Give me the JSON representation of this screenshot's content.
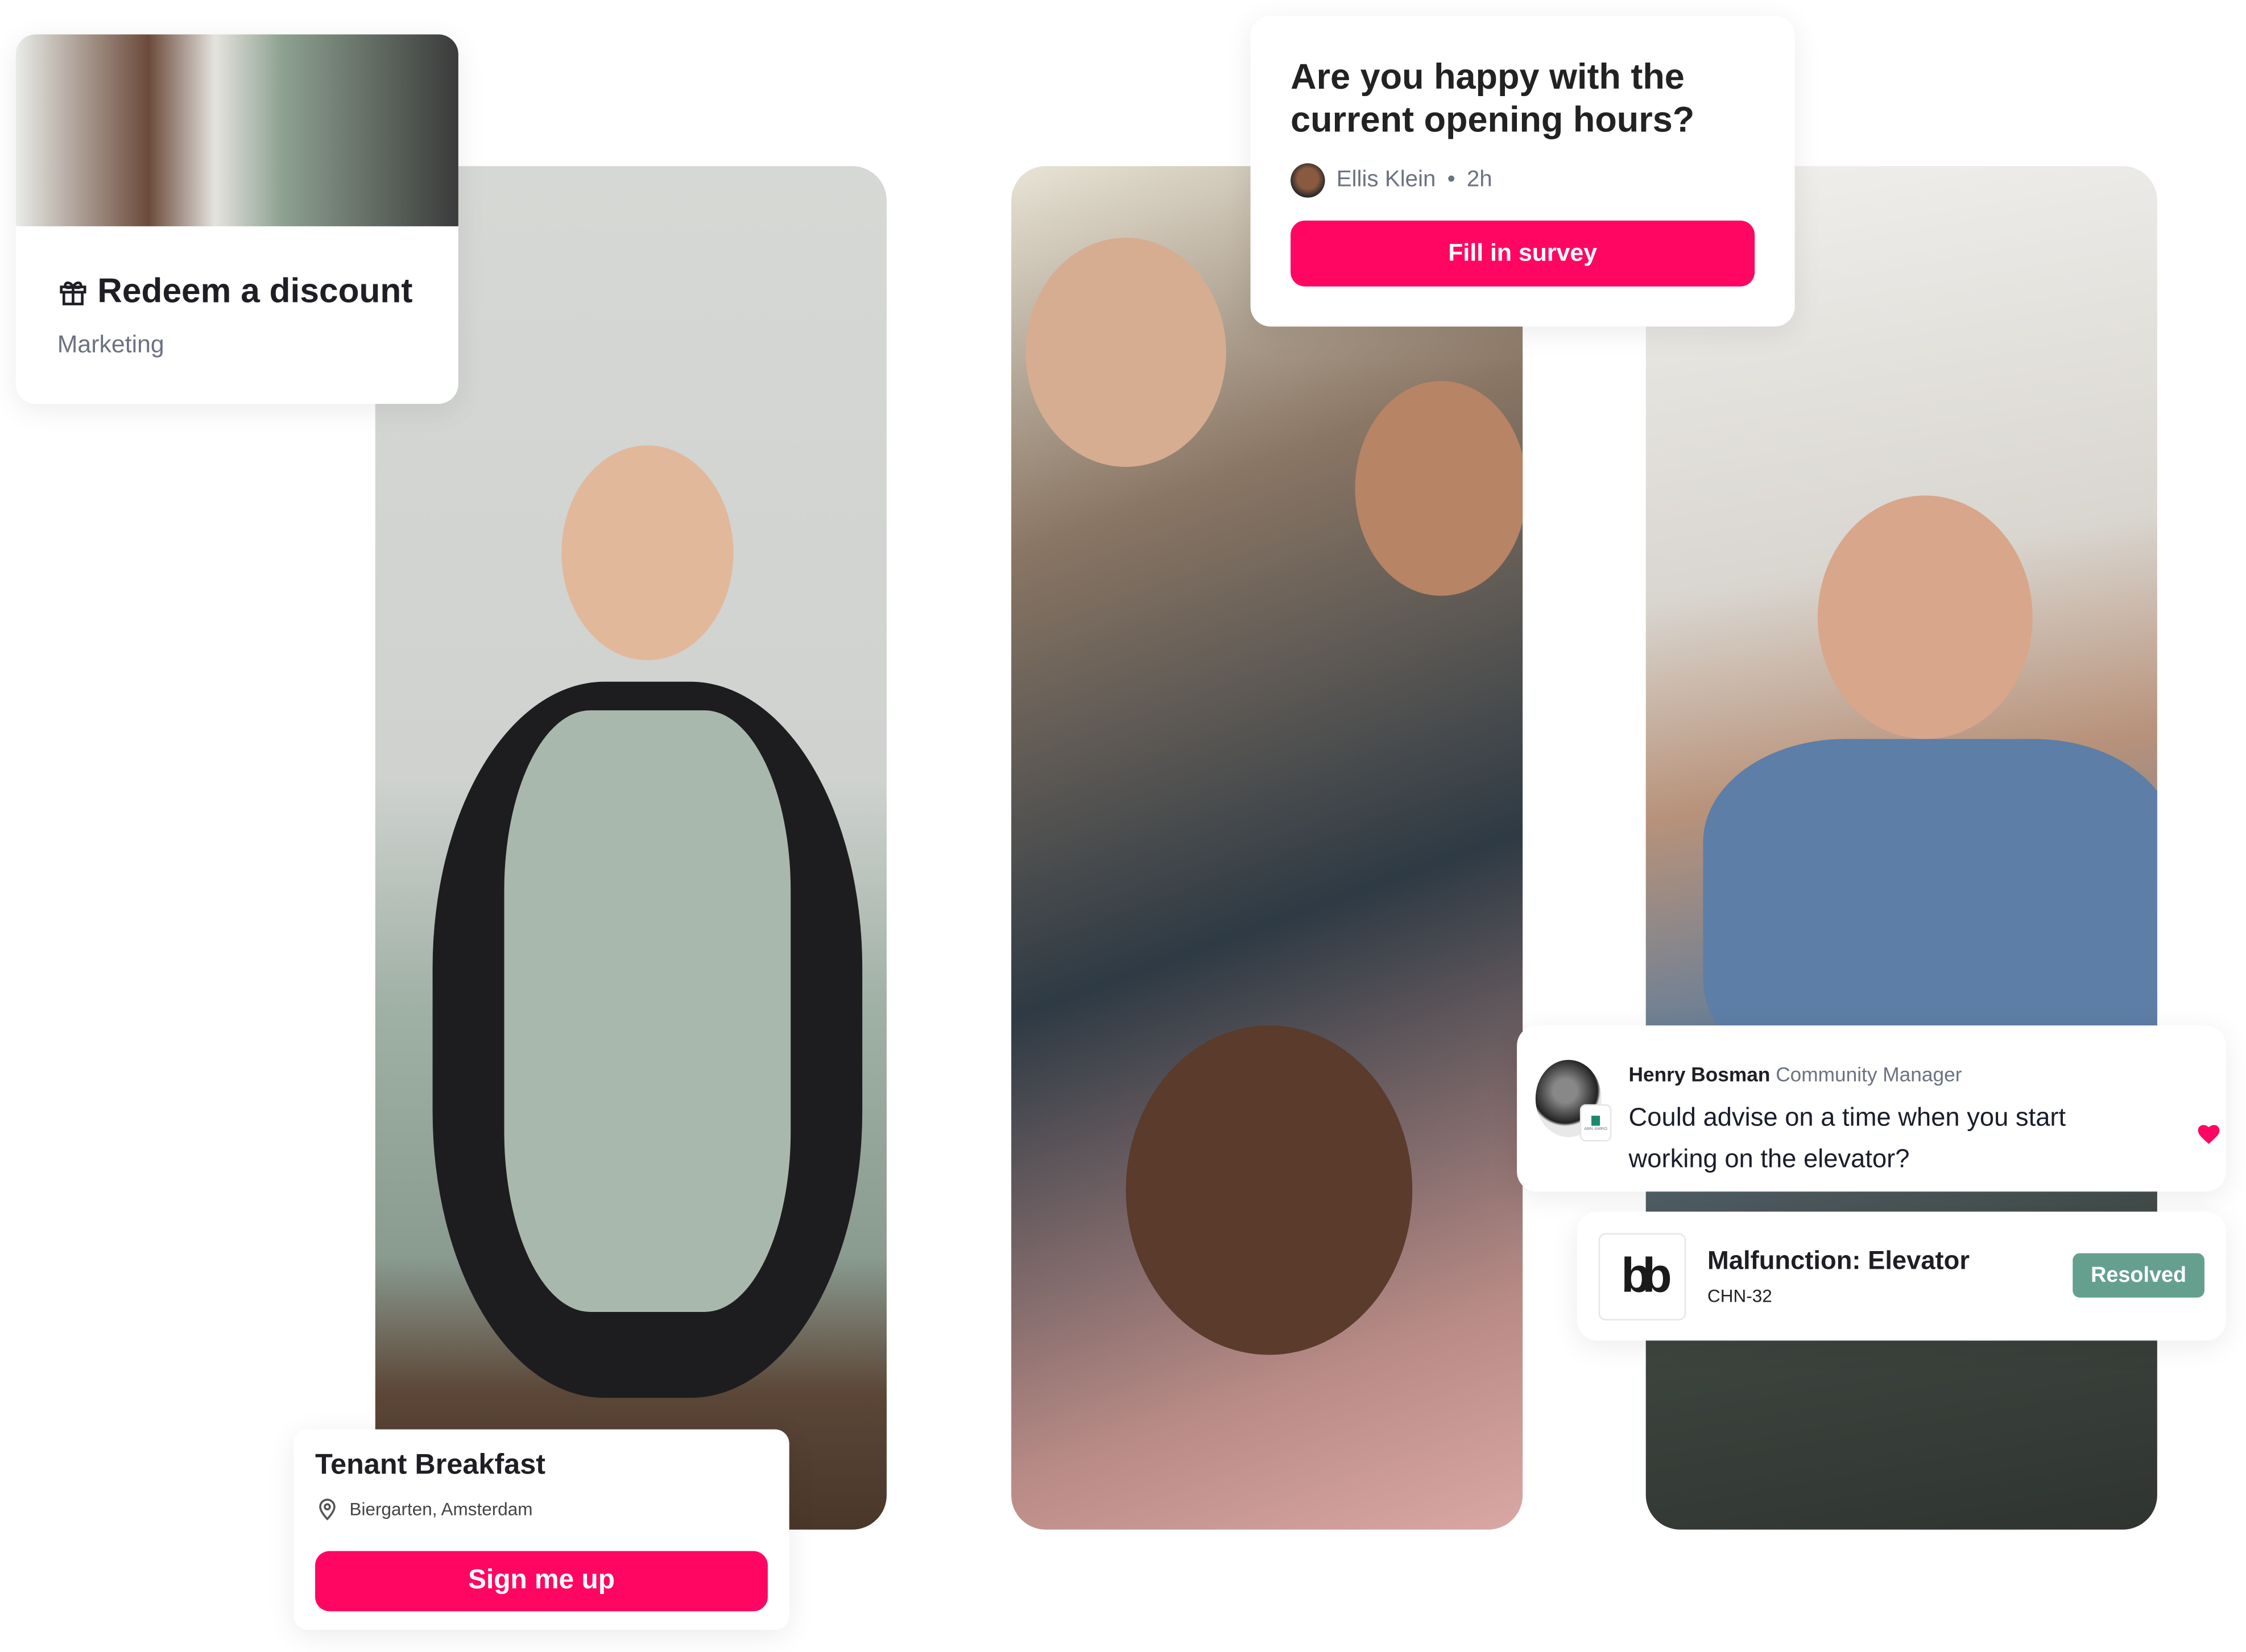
{
  "redeem": {
    "title": "Redeem a discount",
    "category": "Marketing",
    "icon": "gift-icon"
  },
  "survey": {
    "question": "Are you happy with the current opening hours?",
    "author": "Ellis Klein",
    "time": "2h",
    "button": "Fill in survey"
  },
  "event": {
    "title": "Tenant Breakfast",
    "location": "Biergarten, Amsterdam",
    "button": "Sign me up",
    "icon": "location-pin-icon"
  },
  "comment": {
    "author": "Henry Bosman",
    "role": "Community Manager",
    "message": "Could advise on a time when you start working on the elevator?",
    "badge_logo": "ABN·AMRO",
    "reaction_icon": "heart-icon"
  },
  "ticket": {
    "logo": "bb",
    "title": "Malfunction: Elevator",
    "code": "CHN-32",
    "status": "Resolved"
  },
  "colors": {
    "accent": "#ff0662",
    "resolved": "#65a08f",
    "muted": "#6b7280"
  }
}
